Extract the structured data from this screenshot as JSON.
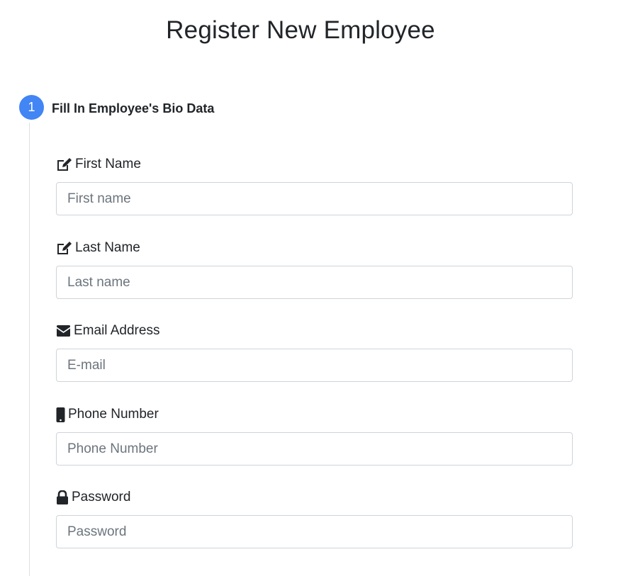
{
  "page": {
    "title": "Register New Employee"
  },
  "step": {
    "number": "1",
    "title": "Fill In Employee's Bio Data"
  },
  "fields": [
    {
      "label": "First Name",
      "placeholder": "First name",
      "value": "",
      "icon": "edit-icon"
    },
    {
      "label": "Last Name",
      "placeholder": "Last name",
      "value": "",
      "icon": "edit-icon"
    },
    {
      "label": "Email Address",
      "placeholder": "E-mail",
      "value": "",
      "icon": "envelope-icon"
    },
    {
      "label": "Phone Number",
      "placeholder": "Phone Number",
      "value": "",
      "icon": "mobile-phone-icon"
    },
    {
      "label": "Password",
      "placeholder": "Password",
      "value": "",
      "icon": "lock-icon"
    }
  ],
  "colors": {
    "step_accent": "#4285f4",
    "text": "#212529",
    "input_border": "#ced4da",
    "placeholder": "#6c757d"
  }
}
